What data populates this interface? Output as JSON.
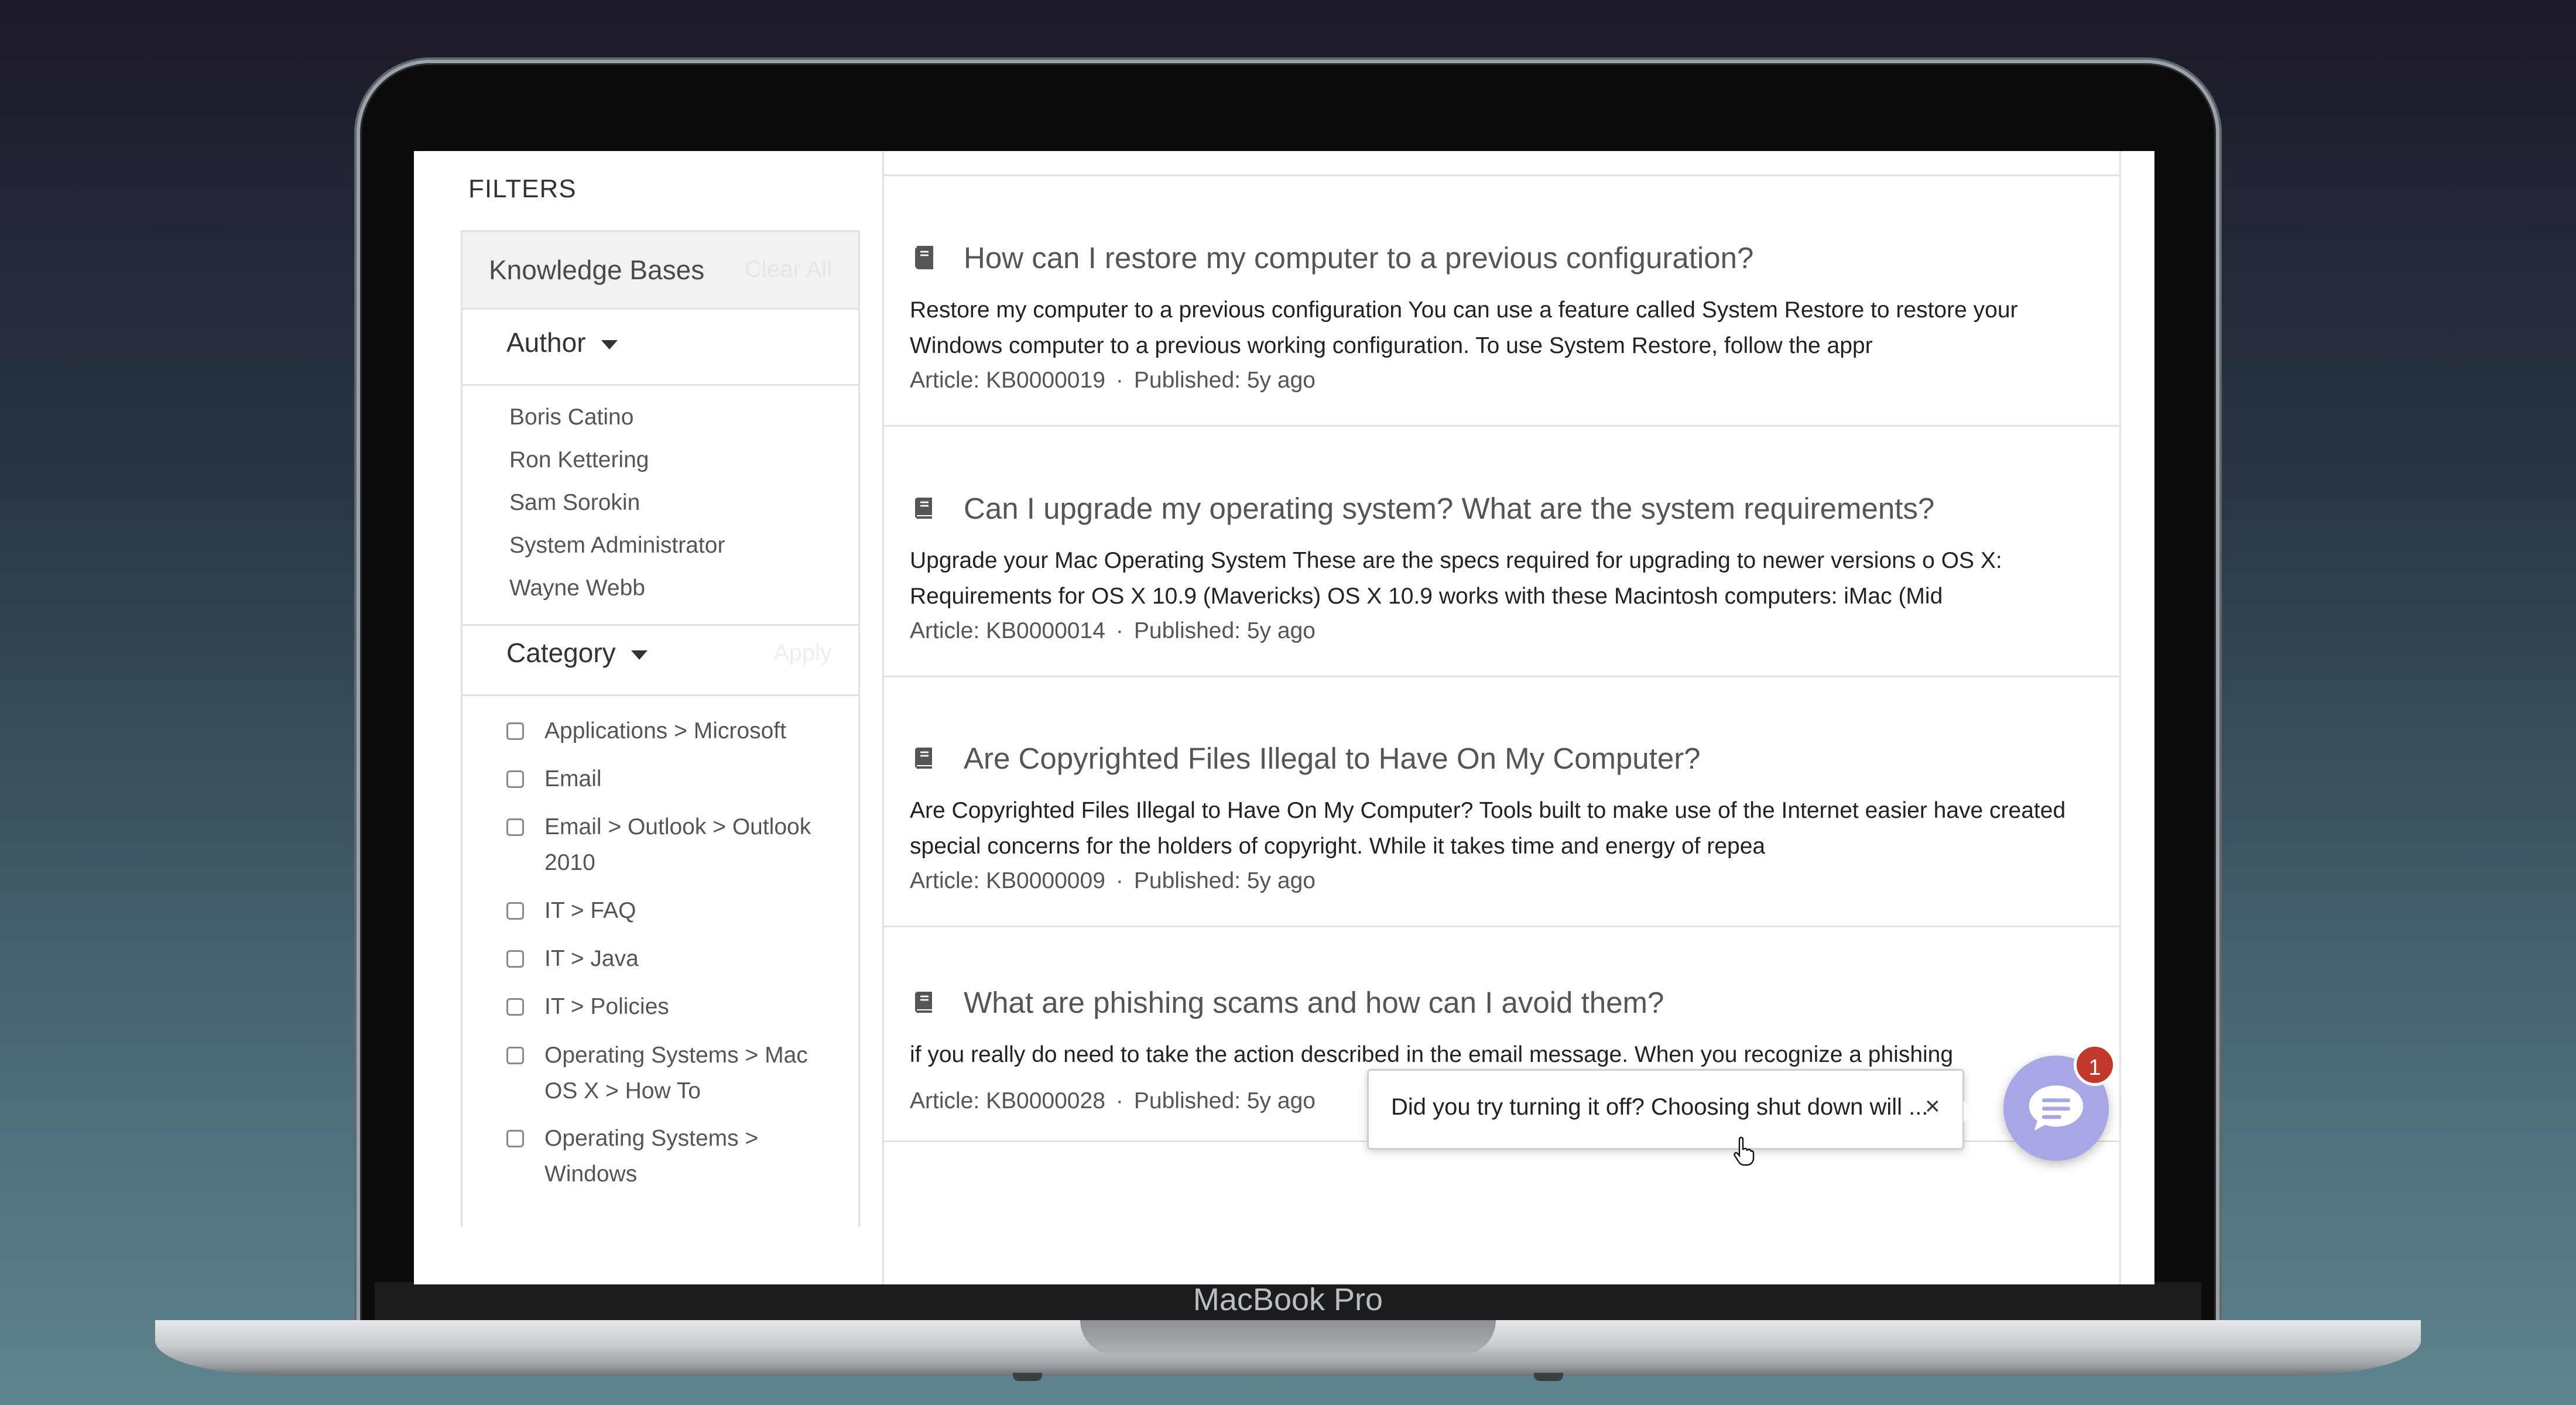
{
  "device": {
    "brand_label": "MacBook Pro"
  },
  "sidebar": {
    "title": "FILTERS",
    "knowledge_bases": {
      "label": "Knowledge Bases",
      "clear_all": "Clear All"
    },
    "author": {
      "label": "Author",
      "items": [
        "Boris Catino",
        "Ron Kettering",
        "Sam Sorokin",
        "System Administrator",
        "Wayne Webb"
      ]
    },
    "category": {
      "label": "Category",
      "apply": "Apply",
      "items": [
        "Applications > Microsoft",
        "Email",
        "Email > Outlook > Outlook 2010",
        "IT > FAQ",
        "IT > Java",
        "IT > Policies",
        "Operating Systems > Mac OS X > How To",
        "Operating Systems > Windows"
      ]
    }
  },
  "articles": [
    {
      "title": "How can I restore my computer to a previous configuration?",
      "snippet": "Restore my computer to a previous configuration You can use a feature called System Restore to restore your Windows computer to a previous working configuration. To use System Restore, follow the appr",
      "article_id": "Article: KB0000019",
      "published": "Published: 5y ago"
    },
    {
      "title": "Can I upgrade my operating system? What are the system requirements?",
      "snippet": "Upgrade your Mac Operating System These are the specs required for upgrading to newer versions o OS X: Requirements for OS X 10.9 (Mavericks) OS X 10.9 works with these Macintosh computers: iMac (Mid",
      "article_id": "Article: KB0000014",
      "published": "Published: 5y ago"
    },
    {
      "title": "Are Copyrighted Files Illegal to Have On My Computer?",
      "snippet": "Are Copyrighted Files Illegal to Have On My Computer? Tools built to make use of the Internet easier have created special concerns for the holders of copyright. While it takes time and energy of repea",
      "article_id": "Article: KB0000009",
      "published": "Published: 5y ago"
    },
    {
      "title": "What are phishing scams and how can I avoid them?",
      "snippet": "if you really do need to take the action described in the email message. When you recognize a phishing",
      "article_id": "Article: KB0000028",
      "published": "Published: 5y ago"
    }
  ],
  "chat": {
    "message": "Did you try turning it off? Choosing shut down will ...",
    "close_glyph": "×",
    "badge_count": "1",
    "accent": "#a9a6e6",
    "badge_color": "#c0392b"
  },
  "meta_separator": "·"
}
